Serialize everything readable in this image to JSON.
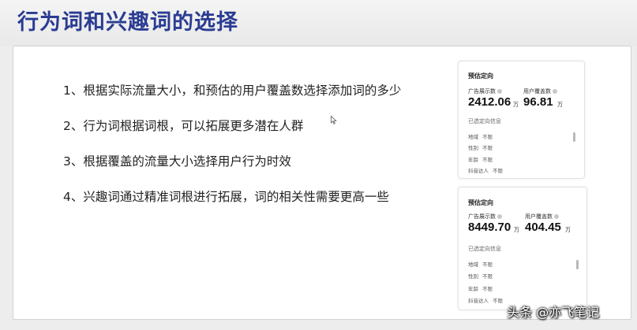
{
  "title": "行为词和兴趣词的选择",
  "points": [
    "1、根据实际流量大小，和预估的用户覆盖数选择添加词的多少",
    "2、行为词根据词根，可以拓展更多潜在人群",
    "3、根据覆盖的流量大小选择用户行为时效",
    "4、兴趣词通过精准词根进行拓展，词的相关性需要更高一些"
  ],
  "cards": [
    {
      "title": "预估定向",
      "impressions_label": "广告展示数",
      "impressions_value": "2412.06",
      "impressions_unit": "万",
      "coverage_label": "用户覆盖数",
      "coverage_value": "96.81",
      "coverage_unit": "万",
      "targets_title": "已选定向信息",
      "targets": [
        {
          "key": "地域",
          "value": "不限"
        },
        {
          "key": "性别",
          "value": "不限"
        },
        {
          "key": "年龄",
          "value": "不限"
        },
        {
          "key": "抖音达人",
          "value": "不限"
        }
      ]
    },
    {
      "title": "预估定向",
      "impressions_label": "广告展示数",
      "impressions_value": "8449.70",
      "impressions_unit": "万",
      "coverage_label": "用户覆盖数",
      "coverage_value": "404.45",
      "coverage_unit": "万",
      "targets_title": "已选定向信息",
      "targets": [
        {
          "key": "地域",
          "value": "不限"
        },
        {
          "key": "性别",
          "value": "不限"
        },
        {
          "key": "年龄",
          "value": "不限"
        },
        {
          "key": "抖音达人",
          "value": "不限"
        }
      ]
    }
  ],
  "watermark": "头条 @亦飞笔记",
  "colors": {
    "title": "#2a3c92",
    "background": "#ededed",
    "slide": "#ffffff"
  }
}
